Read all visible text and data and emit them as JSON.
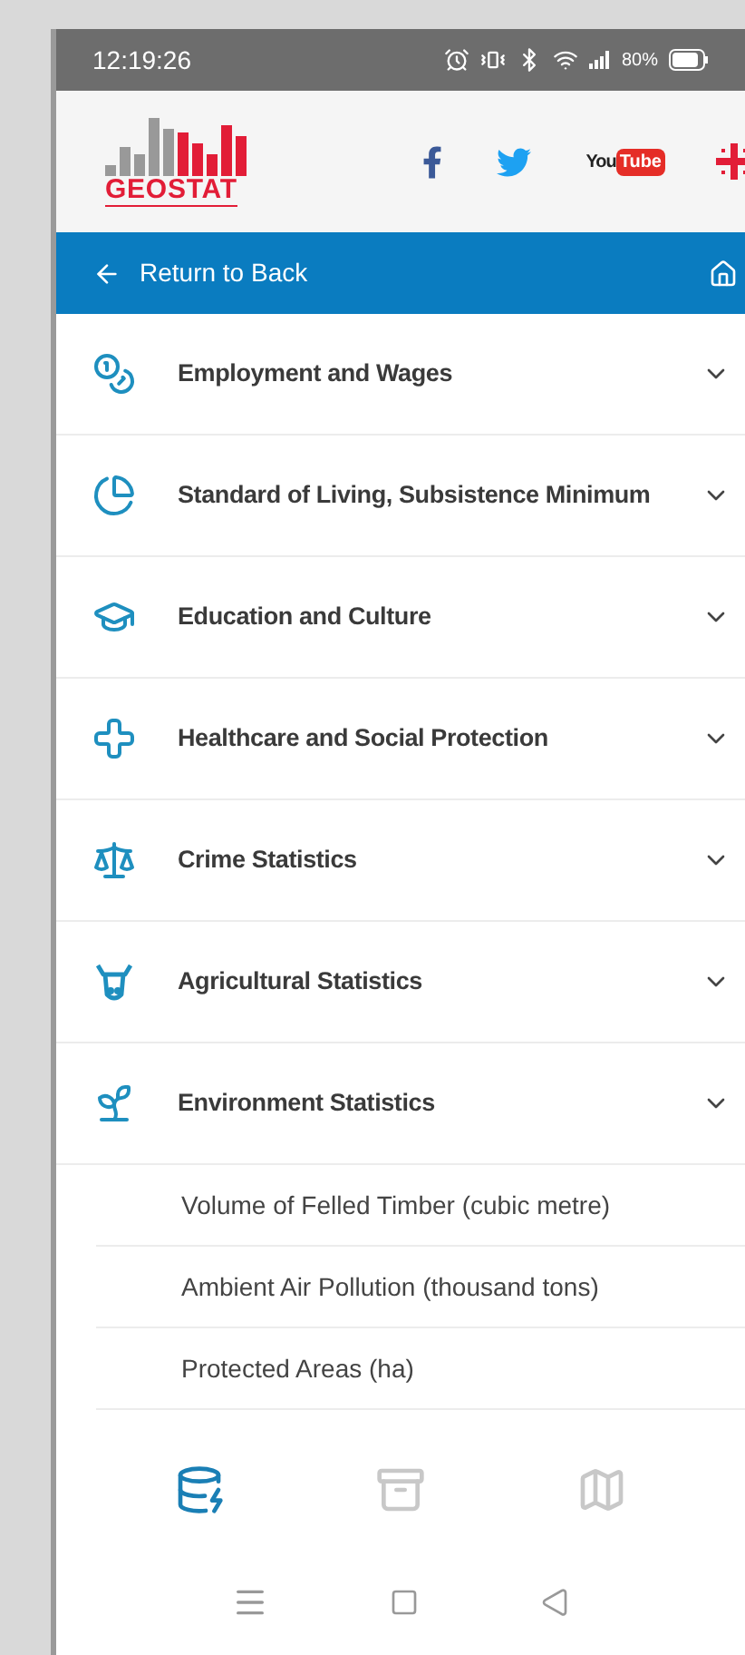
{
  "status_bar": {
    "time": "12:19:26",
    "battery": "80%"
  },
  "header": {
    "logo_text": "GEOSTAT",
    "youtube": {
      "left": "You",
      "right": "Tube"
    }
  },
  "nav_bar": {
    "back_label": "Return to Back"
  },
  "categories": [
    {
      "label": "Employment and Wages"
    },
    {
      "label": "Standard of Living, Subsistence Minimum"
    },
    {
      "label": "Education and Culture"
    },
    {
      "label": "Healthcare and Social Protection"
    },
    {
      "label": "Crime Statistics"
    },
    {
      "label": "Agricultural Statistics"
    },
    {
      "label": "Environment Statistics",
      "children": [
        "Volume of Felled Timber (cubic metre)",
        "Ambient Air Pollution (thousand tons)",
        "Protected Areas (ha)"
      ]
    }
  ],
  "bottom_nav": [
    {
      "selected": true
    },
    {
      "selected": false
    },
    {
      "selected": false
    }
  ]
}
